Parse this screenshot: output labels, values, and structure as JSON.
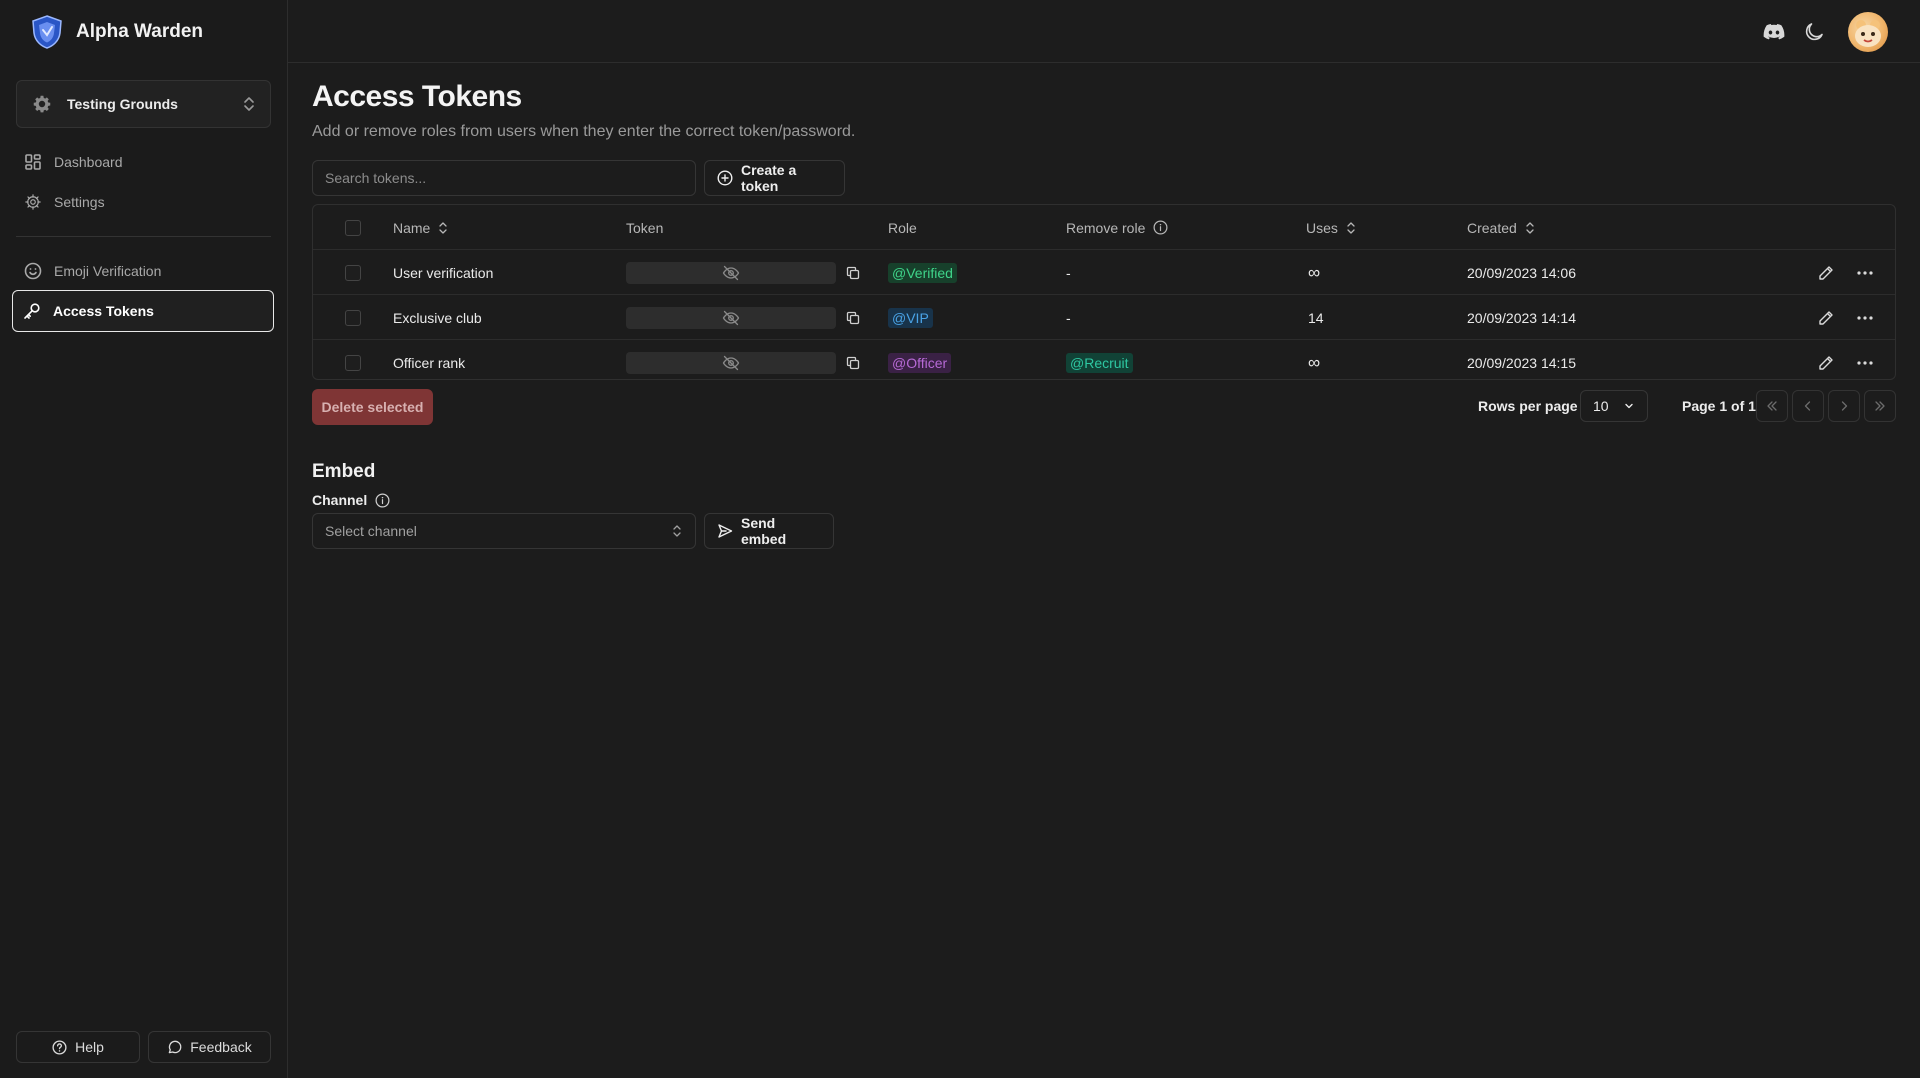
{
  "app": {
    "title": "Alpha Warden"
  },
  "sidebar": {
    "server": "Testing Grounds",
    "items": [
      {
        "label": "Dashboard",
        "icon": "dashboard-icon"
      },
      {
        "label": "Settings",
        "icon": "gear-icon"
      },
      {
        "label": "Emoji Verification",
        "icon": "smiley-icon"
      },
      {
        "label": "Access Tokens",
        "icon": "key-icon",
        "active": true
      }
    ],
    "help_label": "Help",
    "feedback_label": "Feedback"
  },
  "header": {
    "icons": [
      "discord-icon",
      "moon-icon",
      "avatar"
    ]
  },
  "page": {
    "title": "Access Tokens",
    "subtitle": "Add or remove roles from users when they enter the correct token/password.",
    "search_placeholder": "Search tokens...",
    "create_label": "Create a token"
  },
  "table": {
    "columns": {
      "name": "Name",
      "token": "Token",
      "role": "Role",
      "remove_role": "Remove role",
      "uses": "Uses",
      "created": "Created"
    },
    "rows": [
      {
        "name": "User verification",
        "role": "@Verified",
        "remove_role": "-",
        "uses": "∞",
        "created": "20/09/2023 14:06"
      },
      {
        "name": "Exclusive club",
        "role": "@VIP",
        "remove_role": "-",
        "uses": "14",
        "created": "20/09/2023 14:14"
      },
      {
        "name": "Officer rank",
        "role": "@Officer",
        "remove_role": "@Recruit",
        "uses": "∞",
        "created": "20/09/2023 14:15"
      }
    ]
  },
  "role_colors": {
    "@Verified": {
      "fg": "#3fd48a",
      "bg": "#17402b"
    },
    "@VIP": {
      "fg": "#4aa3e6",
      "bg": "#18334a"
    },
    "@Officer": {
      "fg": "#b76ad6",
      "bg": "#3a2145"
    },
    "@Recruit": {
      "fg": "#2ec7a2",
      "bg": "#114236"
    }
  },
  "footer": {
    "delete_label": "Delete selected",
    "rows_per_page_label": "Rows per page",
    "rows_per_page_value": "10",
    "page_label": "Page 1 of 1"
  },
  "embed": {
    "title": "Embed",
    "channel_label": "Channel",
    "channel_placeholder": "Select channel",
    "send_label": "Send embed"
  }
}
